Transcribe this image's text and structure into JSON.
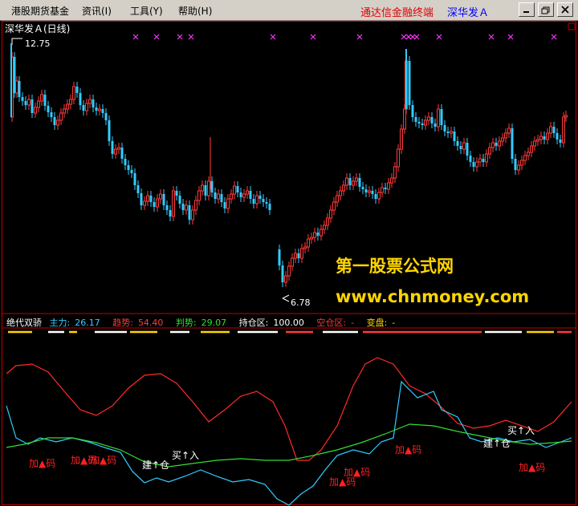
{
  "menu": {
    "items": [
      "港股期货基金",
      "资讯(I)",
      "工具(Y)",
      "帮助(H)"
    ],
    "brand": "通达信金融终端",
    "stock": "深华发Ａ"
  },
  "chart": {
    "title": "深华发Ａ(日线)",
    "high_label": "12.75",
    "low_label": "6.78",
    "watermark_line1": "第一股票公式网",
    "watermark_line2": "www.chnmoney.com",
    "colors": {
      "up": "#ff3b3b",
      "down": "#33ccff",
      "bg": "#000000",
      "grid": "#ff0000"
    }
  },
  "indicator": {
    "name": "绝代双骄",
    "fields": [
      {
        "label": "主力:",
        "value": "26.17",
        "color": "#33ccff"
      },
      {
        "label": "趋势:",
        "value": "54.40",
        "color": "#ff3b3b"
      },
      {
        "label": "判势:",
        "value": "29.07",
        "color": "#33dd33"
      },
      {
        "label": "持仓区:",
        "value": "100.00",
        "color": "#ffffff"
      },
      {
        "label": "空仓区:",
        "value": "-",
        "color": "#ff3b3b"
      },
      {
        "label": "变盘:",
        "value": "-",
        "color": "#ffd500"
      }
    ]
  },
  "signals": [
    {
      "text": "加▲码",
      "color": "red"
    },
    {
      "text": "加▲码",
      "color": "red"
    },
    {
      "text": "加▲码",
      "color": "red"
    },
    {
      "text": "建↑仓",
      "color": "white"
    },
    {
      "text": "买↑入",
      "color": "white"
    },
    {
      "text": "加▲码",
      "color": "red"
    },
    {
      "text": "加▲码",
      "color": "red"
    },
    {
      "text": "加▲码",
      "color": "red"
    },
    {
      "text": "建↑仓",
      "color": "white"
    },
    {
      "text": "买↑入",
      "color": "white"
    },
    {
      "text": "加▲码",
      "color": "red"
    }
  ]
}
